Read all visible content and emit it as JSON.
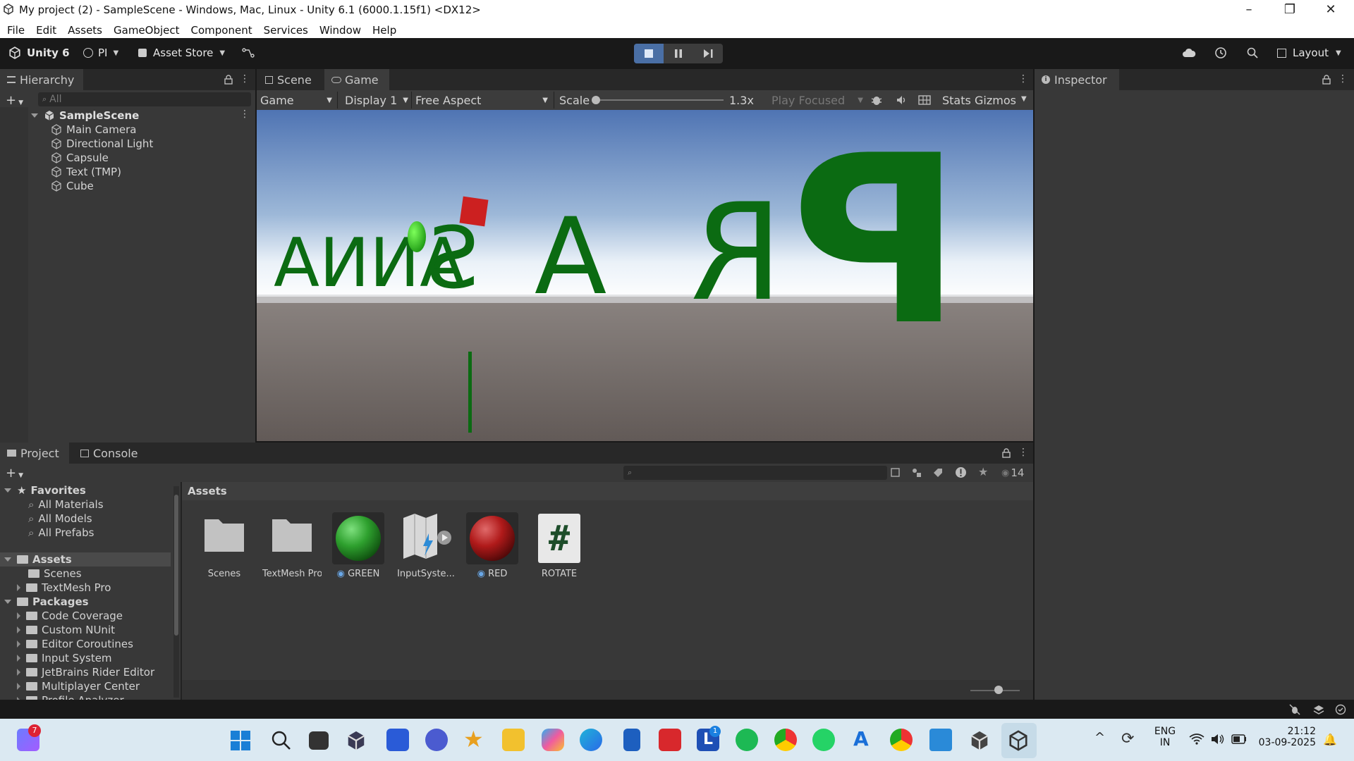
{
  "window": {
    "title": "My project (2) - SampleScene - Windows, Mac, Linux - Unity 6.1 (6000.1.15f1) <DX12>",
    "minimize": "–",
    "restore": "❐",
    "close": "✕"
  },
  "menu": [
    "File",
    "Edit",
    "Assets",
    "GameObject",
    "Component",
    "Services",
    "Window",
    "Help"
  ],
  "toolbar": {
    "unity_label": "Unity 6",
    "account": "PI",
    "asset_store": "Asset Store",
    "layout": "Layout"
  },
  "tabs": {
    "hierarchy": "Hierarchy",
    "scene": "Scene",
    "game": "Game",
    "inspector": "Inspector",
    "project": "Project",
    "console": "Console"
  },
  "hierarchy": {
    "search_placeholder": "All",
    "scene_name": "SampleScene",
    "items": [
      "Main Camera",
      "Directional Light",
      "Capsule",
      "Text (TMP)",
      "Cube"
    ]
  },
  "game_toolbar": {
    "mode": "Game",
    "display": "Display 1",
    "aspect": "Free Aspect",
    "scale_label": "Scale",
    "scale_value": "1.3x",
    "scale_fraction": 0.0,
    "play_focused": "Play Focused",
    "stats": "Stats",
    "gizmos": "Gizmos"
  },
  "game_view": {
    "text": "PRASANNA",
    "text_color": "#0b6b12",
    "sky_top": "#5a7fbf",
    "ground": "#6e6562"
  },
  "project": {
    "favorites_label": "Favorites",
    "favorites": [
      "All Materials",
      "All Models",
      "All Prefabs"
    ],
    "assets_label": "Assets",
    "asset_folders": [
      "Scenes",
      "TextMesh Pro"
    ],
    "packages_label": "Packages",
    "packages": [
      "Code Coverage",
      "Custom NUnit",
      "Editor Coroutines",
      "Input System",
      "JetBrains Rider Editor",
      "Multiplayer Center",
      "Profile Analyzer"
    ],
    "breadcrumb": "Assets",
    "visible_count": "14",
    "items": [
      {
        "name": "Scenes",
        "kind": "folder"
      },
      {
        "name": "TextMesh Pro",
        "kind": "folder"
      },
      {
        "name": "GREEN",
        "kind": "material",
        "color": "#2ea02e"
      },
      {
        "name": "InputSyste...",
        "kind": "input"
      },
      {
        "name": "RED",
        "kind": "material",
        "color": "#b01a1a"
      },
      {
        "name": "ROTATE",
        "kind": "script",
        "glyph": "#"
      }
    ]
  },
  "taskbar": {
    "lang_line1": "ENG",
    "lang_line2": "IN",
    "time": "21:12",
    "date": "03-09-2025",
    "badge_teams": "7",
    "badge_l": "1"
  }
}
